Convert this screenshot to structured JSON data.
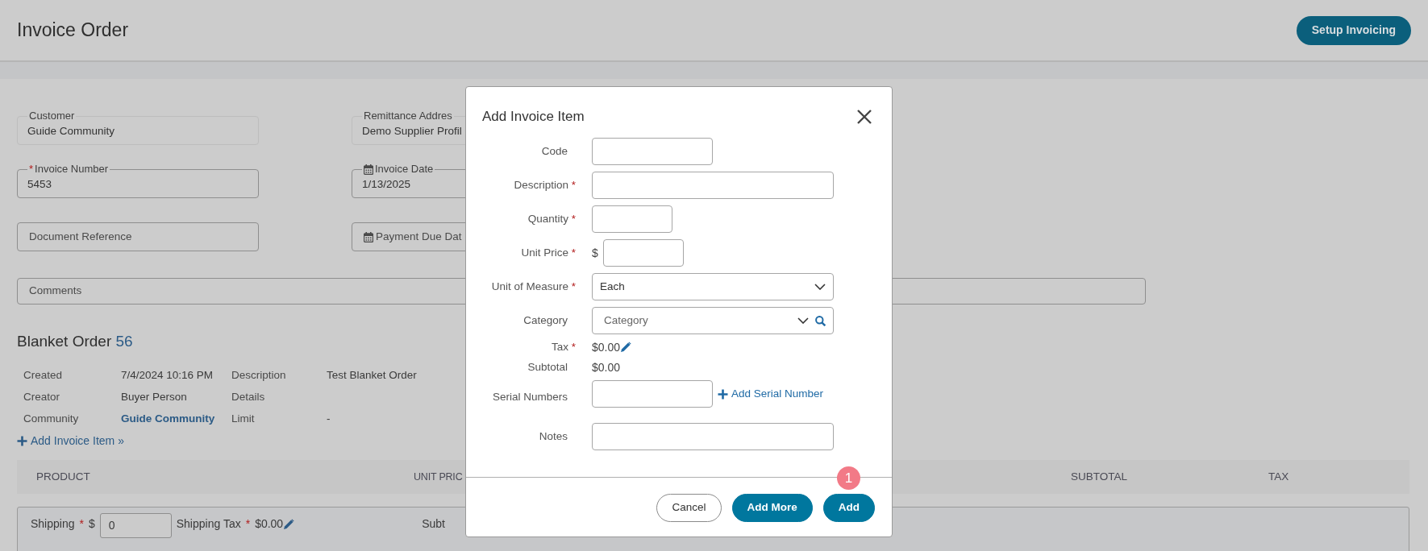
{
  "header": {
    "title": "Invoice Order",
    "button": "Setup Invoicing"
  },
  "required_mark": "*",
  "field_rows": [
    [
      {
        "label": "Customer",
        "value": "Guide Community",
        "kind": "readonly",
        "required": false
      },
      {
        "label": "Remittance Addres",
        "value": "Demo Supplier Profil",
        "kind": "readonly",
        "required": false
      }
    ],
    [
      {
        "label": "Invoice Number",
        "value": "5453",
        "kind": "text",
        "required": true
      },
      {
        "label": "Invoice Date",
        "value": "1/13/2025",
        "kind": "date",
        "required": false
      }
    ],
    [
      {
        "label": "Document Reference",
        "kind": "text",
        "required": false
      },
      {
        "label": "Payment Due Dat",
        "kind": "date",
        "required": false
      }
    ],
    [
      {
        "label": "Comments",
        "kind": "text",
        "required": false
      }
    ]
  ],
  "blanket_order": {
    "title": "Blanket Order",
    "number": "56",
    "details": [
      {
        "label": "Created",
        "value": "7/4/2024 10:16 PM",
        "link": false
      },
      {
        "label": "Description",
        "value": "Test Blanket Order",
        "link": false
      },
      {
        "label": "Creator",
        "value": "Buyer Person",
        "link": false
      },
      {
        "label": "Details"
      },
      {
        "label": "Community",
        "value": "Guide Community",
        "link": true
      },
      {
        "label": "Limit",
        "value": "-",
        "link": false
      }
    ]
  },
  "add_item_link": "Add Invoice Item »",
  "table": {
    "columns": [
      "PRODUCT",
      "UNIT PRIC",
      "SUBTOTAL",
      "TAX"
    ]
  },
  "shipping": {
    "label": "Shipping",
    "required": true,
    "currency": "$",
    "value": "0",
    "tax_label": "Shipping Tax",
    "tax_required": true,
    "tax_value": "$0.00",
    "subtotal_label": "Subt"
  },
  "modal": {
    "title": "Add Invoice Item",
    "fields": [
      {
        "label": "Code",
        "kind": "text",
        "required": false
      },
      {
        "label": "Description",
        "kind": "text",
        "required": true
      },
      {
        "label": "Quantity",
        "kind": "text",
        "required": true
      },
      {
        "label": "Unit Price",
        "kind": "money",
        "required": true,
        "currency": "$"
      },
      {
        "label": "Unit of Measure",
        "kind": "select",
        "required": true,
        "value": "Each"
      },
      {
        "label": "Category",
        "kind": "search-select",
        "required": false,
        "placeholder": "Category"
      },
      {
        "label": "Tax",
        "kind": "value",
        "required": true,
        "value": "$0.00",
        "editable": true
      },
      {
        "label": "Subtotal",
        "kind": "value",
        "required": false,
        "value": "$0.00",
        "editable": false
      },
      {
        "label": "Serial Numbers",
        "kind": "serial",
        "required": false,
        "link": "Add Serial Number"
      },
      {
        "label": "Notes",
        "kind": "text",
        "required": false
      }
    ],
    "buttons": [
      {
        "label": "Cancel",
        "kind": "secondary"
      },
      {
        "label": "Add More",
        "kind": "primary"
      },
      {
        "label": "Add",
        "kind": "primary"
      }
    ],
    "step_badge": "1"
  }
}
